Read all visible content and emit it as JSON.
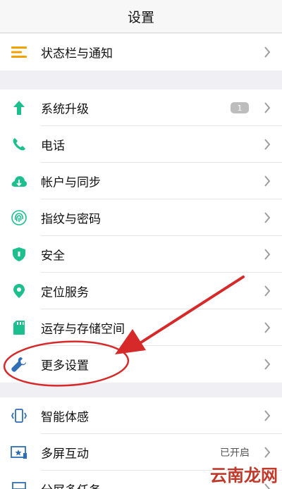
{
  "header": {
    "title": "设置"
  },
  "colors": {
    "accent": "#1dbf8e",
    "annotation": "#d62a2a"
  },
  "groups": [
    {
      "items": [
        {
          "icon": "list-icon",
          "label": "状态栏与通知"
        }
      ]
    },
    {
      "items": [
        {
          "icon": "arrow-up-icon",
          "label": "系统升级",
          "badge": "1"
        },
        {
          "icon": "phone-icon",
          "label": "电话"
        },
        {
          "icon": "cloud-sync-icon",
          "label": "帐户与同步"
        },
        {
          "icon": "fingerprint-icon",
          "label": "指纹与密码"
        },
        {
          "icon": "shield-icon",
          "label": "安全"
        },
        {
          "icon": "location-pin-icon",
          "label": "定位服务"
        },
        {
          "icon": "sd-card-icon",
          "label": "运存与存储空间"
        },
        {
          "icon": "wrench-icon",
          "label": "更多设置"
        }
      ]
    },
    {
      "items": [
        {
          "icon": "smart-motion-icon",
          "label": "智能体感"
        },
        {
          "icon": "multi-screen-icon",
          "label": "多屏互动",
          "value": "已开启"
        },
        {
          "icon": "split-screen-icon",
          "label": "分屏多任务"
        }
      ]
    }
  ],
  "watermark": "云南龙网"
}
